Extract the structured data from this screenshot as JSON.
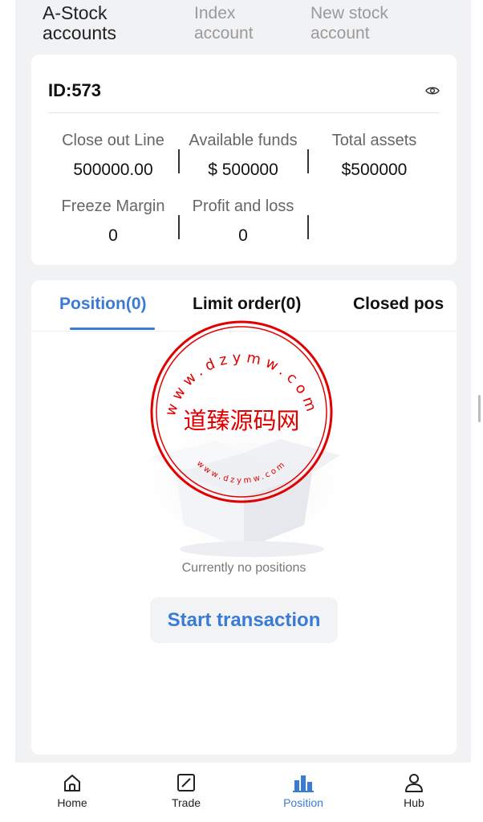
{
  "account_tabs": [
    {
      "label": "A-Stock accounts",
      "active": true
    },
    {
      "label": "Index account",
      "active": false
    },
    {
      "label": "New stock account",
      "active": false
    }
  ],
  "account": {
    "id_text": "ID:573",
    "stats": [
      {
        "label": "Close out Line",
        "value": "500000.00"
      },
      {
        "label": "Available funds",
        "value": "$ 500000"
      },
      {
        "label": "Total assets",
        "value": "$500000"
      },
      {
        "label": "Freeze Margin",
        "value": "0"
      },
      {
        "label": "Profit and loss",
        "value": "0"
      }
    ]
  },
  "position_tabs": [
    {
      "label": "Position(0)",
      "active": true
    },
    {
      "label": "Limit order(0)",
      "active": false
    },
    {
      "label": "Closed pos",
      "active": false
    }
  ],
  "empty_state": {
    "message": "Currently no positions",
    "button_label": "Start transaction"
  },
  "watermark": {
    "center_text": "道臻源码网",
    "ring_text_top": "www.dzymw.com",
    "ring_text_bottom": "www.dzymw.com",
    "color": "#e00000"
  },
  "bottom_nav": [
    {
      "label": "Home",
      "icon": "home-icon",
      "active": false
    },
    {
      "label": "Trade",
      "icon": "trade-icon",
      "active": false
    },
    {
      "label": "Position",
      "icon": "position-icon",
      "active": true
    },
    {
      "label": "Hub",
      "icon": "user-icon",
      "active": false
    }
  ],
  "colors": {
    "accent": "#3a7bd5",
    "background": "#f1f2f4"
  }
}
